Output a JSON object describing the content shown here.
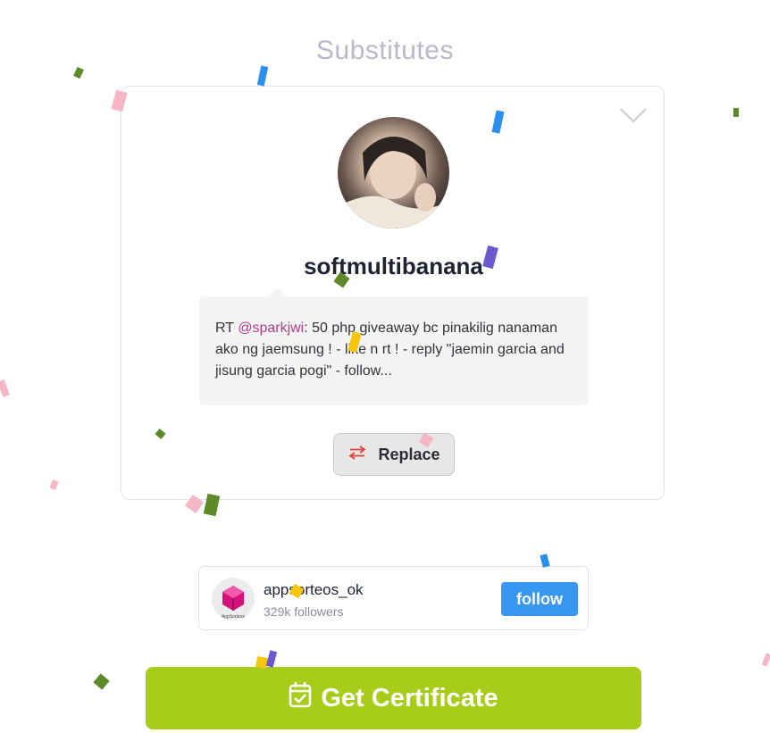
{
  "section": {
    "title": "Substitutes"
  },
  "winner": {
    "username": "softmultibanana",
    "tweet_prefix": "RT ",
    "tweet_mention": "@sparkjwi",
    "tweet_body": ": 50 php giveaway bc pinakilig nanaman ako ng jaemsung ! - like n rt ! - reply \"jaemin garcia and jisung garcia pogi\" - follow..."
  },
  "actions": {
    "replace_label": "Replace"
  },
  "follow_widget": {
    "account_name": "appsorteos_ok",
    "followers": "329k followers",
    "follow_label": "follow",
    "logo_caption": "AppSorteos"
  },
  "certificate": {
    "label": "Get Certificate"
  },
  "colors": {
    "accent_green": "#a7cc1a",
    "follow_blue": "#3897f0",
    "mention": "#b03c8a",
    "title_gray": "#b8b9c9"
  },
  "icons": [
    "chevron-down-icon",
    "swap-arrows-icon",
    "calendar-check-icon",
    "appsorteos-logo-icon"
  ]
}
